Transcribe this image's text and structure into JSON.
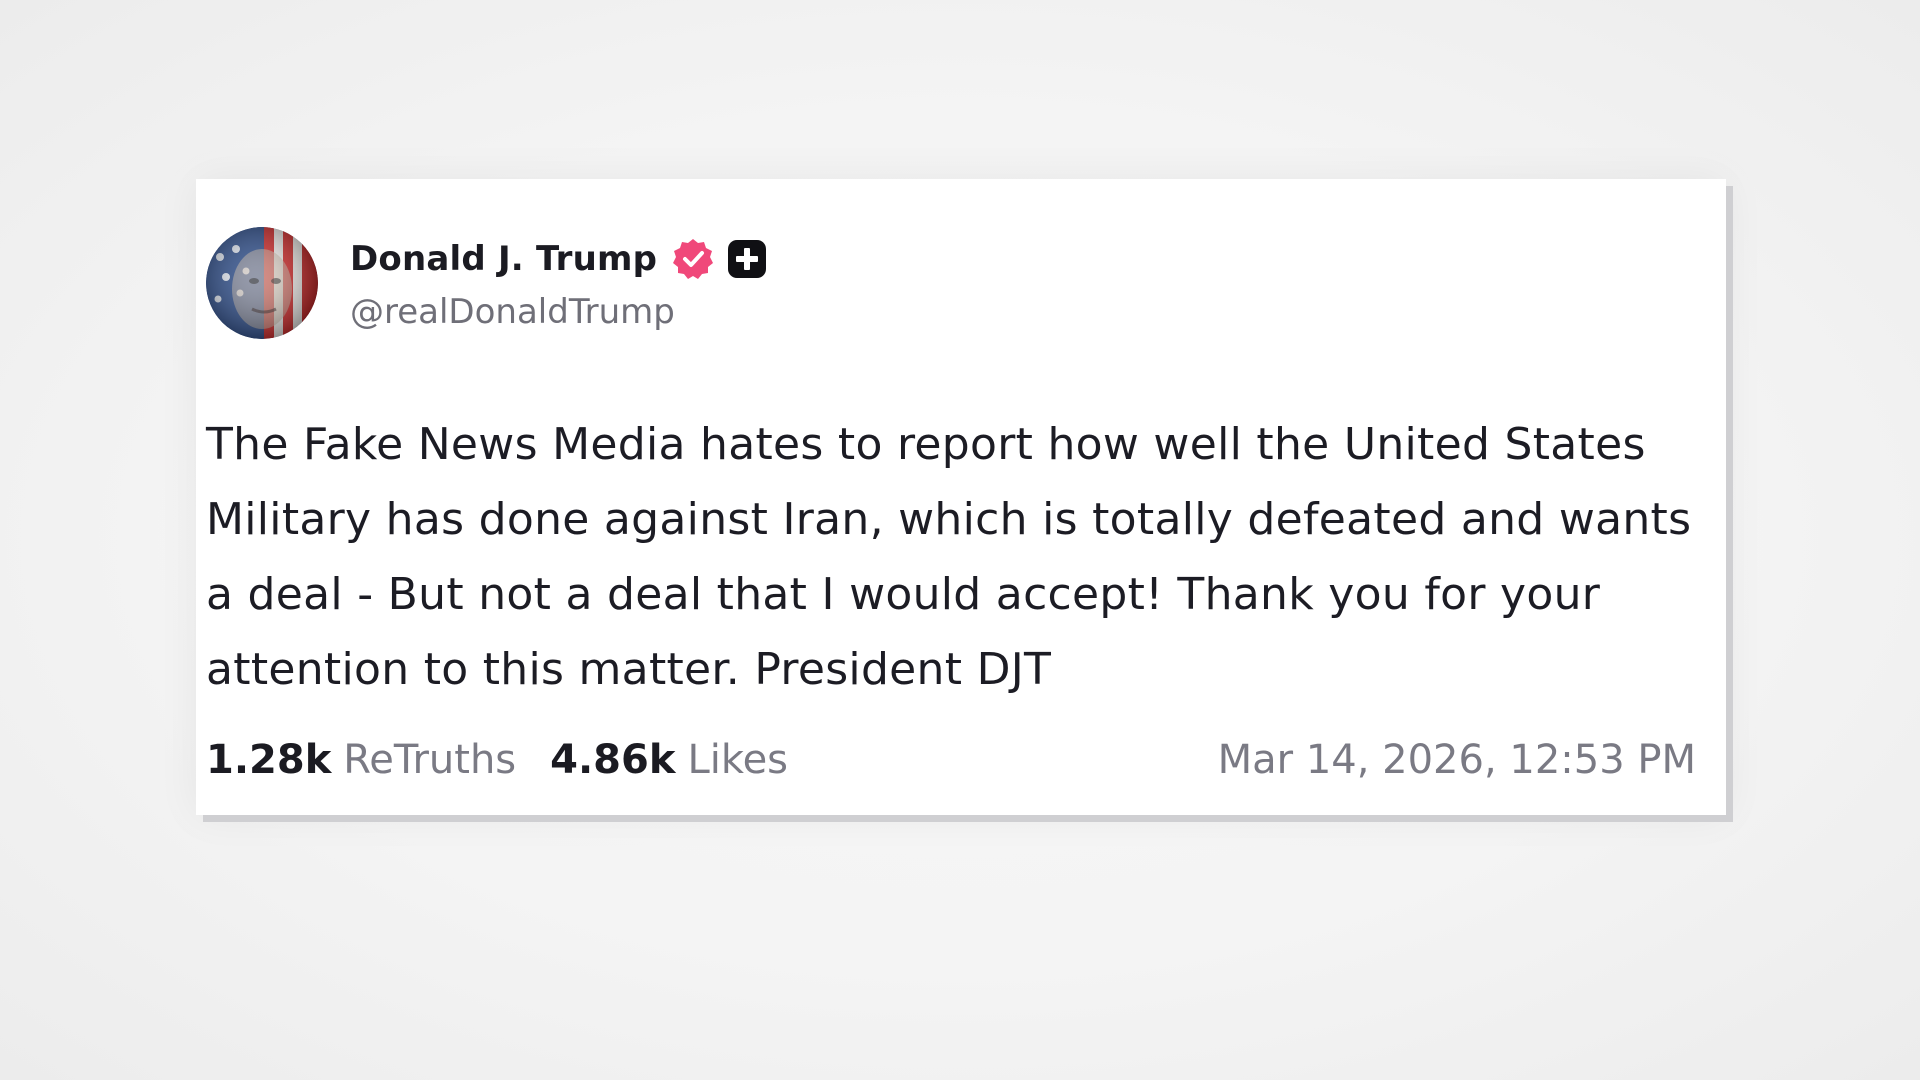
{
  "post": {
    "author": {
      "display_name": "Donald J. Trump",
      "handle": "@realDonaldTrump",
      "verified_icon": "verified-badge-icon",
      "badge_icon": "plus-badge-icon",
      "verified_color": "#f0487a"
    },
    "text": "The Fake News Media hates to report how well the United States Military has done against Iran, which is totally defeated and wants a deal - But not a deal that I would accept! Thank you for your attention to this matter. President DJT",
    "retruths": {
      "count": "1.28k",
      "label": "ReTruths"
    },
    "likes": {
      "count": "4.86k",
      "label": "Likes"
    },
    "timestamp": "Mar 14, 2026, 12:53 PM"
  }
}
